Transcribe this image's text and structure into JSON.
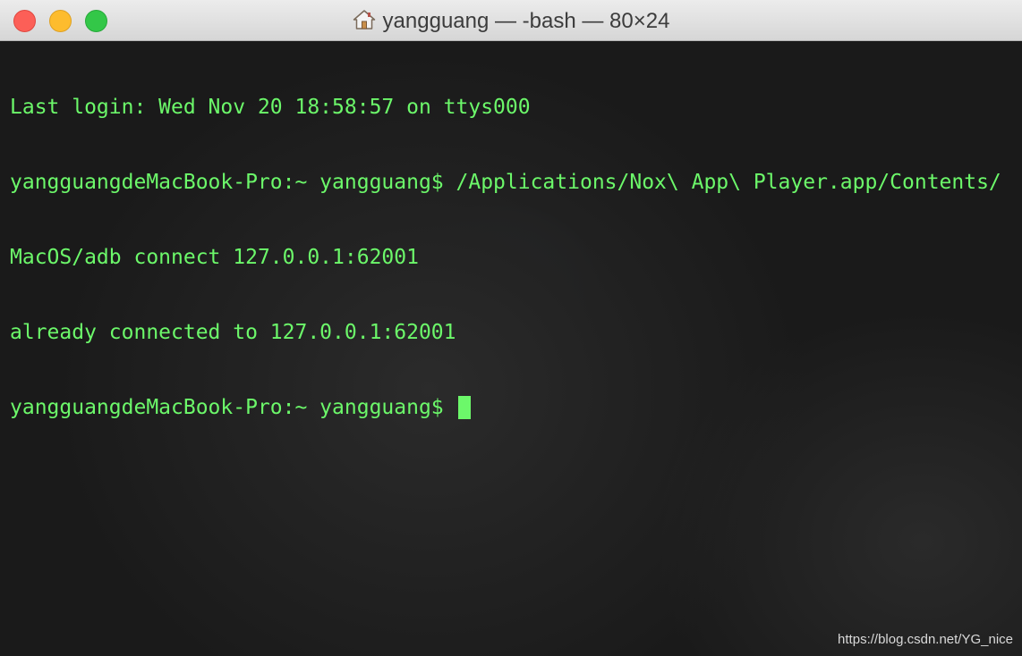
{
  "window": {
    "title": "yangguang — -bash — 80×24",
    "home_icon": "home-icon"
  },
  "terminal": {
    "lines": [
      "Last login: Wed Nov 20 18:58:57 on ttys000",
      "yangguangdeMacBook-Pro:~ yangguang$ /Applications/Nox\\ App\\ Player.app/Contents/",
      "MacOS/adb connect 127.0.0.1:62001",
      "already connected to 127.0.0.1:62001",
      "yangguangdeMacBook-Pro:~ yangguang$ "
    ],
    "text_color": "#6cf86a",
    "background_color": "#1a1a1a"
  },
  "watermark": "https://blog.csdn.net/YG_nice"
}
